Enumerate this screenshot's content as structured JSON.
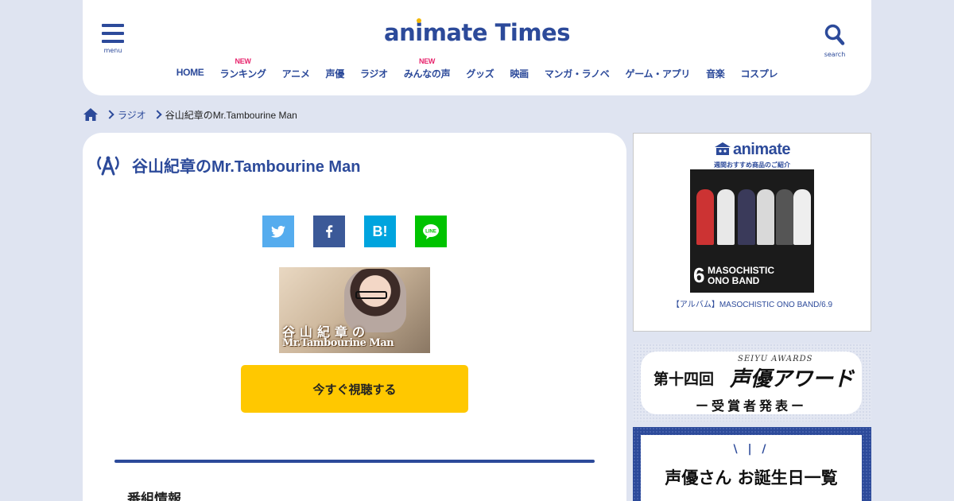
{
  "header": {
    "menu_label": "menu",
    "search_label": "search",
    "logo_pre": "an",
    "logo_i": "i",
    "logo_post": "mate Times",
    "nav": [
      {
        "label": "HOME",
        "badge": ""
      },
      {
        "label": "ランキング",
        "badge": "NEW"
      },
      {
        "label": "アニメ",
        "badge": ""
      },
      {
        "label": "声優",
        "badge": ""
      },
      {
        "label": "ラジオ",
        "badge": ""
      },
      {
        "label": "みんなの声",
        "badge": "NEW"
      },
      {
        "label": "グッズ",
        "badge": ""
      },
      {
        "label": "映画",
        "badge": ""
      },
      {
        "label": "マンガ・ラノベ",
        "badge": ""
      },
      {
        "label": "ゲーム・アプリ",
        "badge": ""
      },
      {
        "label": "音楽",
        "badge": ""
      },
      {
        "label": "コスプレ",
        "badge": ""
      }
    ]
  },
  "breadcrumb": {
    "items": [
      "ラジオ"
    ],
    "current": "谷山紀章のMr.Tambourine Man"
  },
  "article": {
    "title": "谷山紀章のMr.Tambourine Man",
    "share": {
      "hatena": "B!",
      "line": "LINE"
    },
    "thumb_title_line1": "谷山紀章の",
    "thumb_title_line2": "Mr.Tambourine Man",
    "cta_label": "今すぐ視聴する",
    "section_heading": "番組情報"
  },
  "sidebar": {
    "ad": {
      "brand": "animate",
      "subtitle": "週間おすすめ商品のご紹介",
      "cover_number": "6",
      "cover_text_line1": "MASOCHISTIC",
      "cover_text_line2": "ONO BAND",
      "caption": "【アルバム】MASOCHISTIC ONO BAND/6.9"
    },
    "award": {
      "english": "SEIYU AWARDS",
      "ordinal": "第十四回",
      "name": "声優アワード",
      "sub": "ー受賞者発表ー"
    },
    "birthday": {
      "marks": "\\ | /",
      "text": "声優さん お誕生日一覧"
    }
  },
  "colors": {
    "brand_blue": "#2c4a9a",
    "accent_yellow": "#ffc800",
    "new_badge": "#e7236c",
    "background": "#dfe4f1"
  }
}
